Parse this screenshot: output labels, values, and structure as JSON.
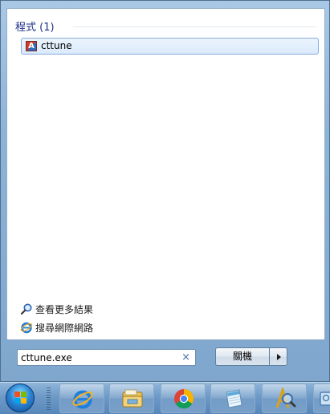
{
  "results": {
    "group_header": "程式 (1)",
    "items": [
      {
        "label": "cttune",
        "icon": "cttune-app-icon"
      }
    ]
  },
  "links": {
    "see_more": {
      "label": "查看更多結果",
      "icon": "magnifier-icon"
    },
    "search_web": {
      "label": "搜尋網際網路",
      "icon": "internet-explorer-icon"
    }
  },
  "search": {
    "value": "cttune.exe",
    "clear_symbol": "×"
  },
  "shutdown": {
    "label": "關機"
  },
  "taskbar": {
    "items": [
      {
        "icon": "windows-start-orb-icon"
      },
      {
        "icon": "internet-explorer-icon"
      },
      {
        "icon": "file-explorer-icon"
      },
      {
        "icon": "chrome-icon"
      },
      {
        "icon": "notepad-icon"
      },
      {
        "icon": "magnifier-app-icon"
      }
    ]
  },
  "colors": {
    "header_text": "#1e3287",
    "selected_border": "#84acdd",
    "taskbar": "#6d99c6"
  }
}
